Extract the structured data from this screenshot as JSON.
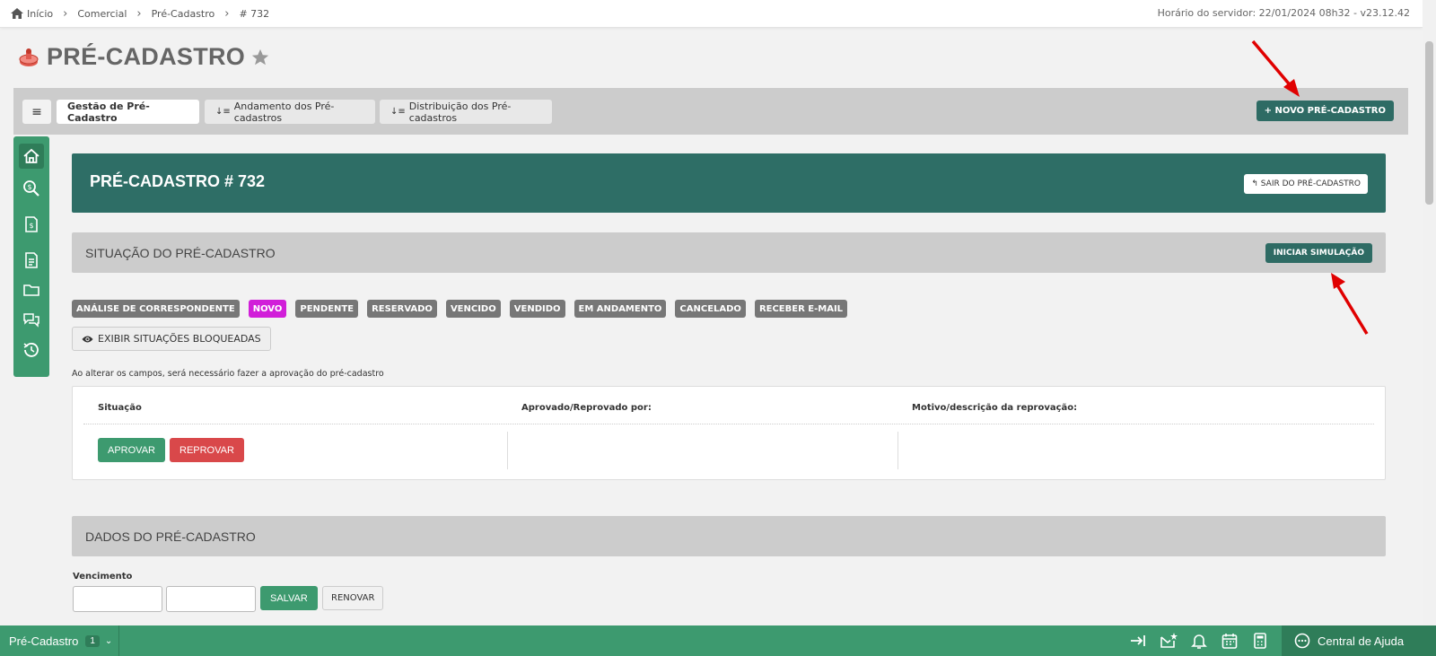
{
  "breadcrumb": {
    "items": [
      "Início",
      "Comercial",
      "Pré-Cadastro",
      "# 732"
    ]
  },
  "server_time": "Horário do servidor: 22/01/2024 08h32 - v23.12.42",
  "page": {
    "title": "PRÉ-CADASTRO"
  },
  "tabs": {
    "menu_glyph": "≡",
    "sort_glyph": "↓≡",
    "items": [
      "Gestão de Pré-Cadastro",
      "Andamento dos Pré-cadastros",
      "Distribuição dos Pré-cadastros"
    ],
    "new_button": "+ NOVO PRÉ-CADASTRO"
  },
  "header": {
    "title": "PRÉ-CADASTRO # 732",
    "exit_button": "↰ SAIR DO PRÉ-CADASTRO"
  },
  "situacao": {
    "title": "SITUAÇÃO DO PRÉ-CADASTRO",
    "start_button": "INICIAR SIMULAÇÃO",
    "badges": [
      "ANÁLISE DE CORRESPONDENTE",
      "NOVO",
      "PENDENTE",
      "RESERVADO",
      "VENCIDO",
      "VENDIDO",
      "EM ANDAMENTO",
      "CANCELADO",
      "RECEBER E-MAIL"
    ],
    "show_blocked": "EXIBIR SITUAÇÕES BLOQUEADAS",
    "note": "Ao alterar os campos, será necessário fazer a aprovação do pré-cadastro",
    "table_headers": [
      "Situação",
      "Aprovado/Reprovado por:",
      "Motivo/descrição da reprovação:"
    ],
    "approve": "APROVAR",
    "reject": "REPROVAR"
  },
  "dados": {
    "title": "DADOS DO PRÉ-CADASTRO",
    "vencimento_label": "Vencimento",
    "save": "SALVAR",
    "renew": "RENOVAR"
  },
  "bottom": {
    "module": "Pré-Cadastro",
    "count": "1",
    "chevron": "⌄",
    "help": "Central de Ajuda"
  },
  "colors": {
    "primary_dark": "#2e6b64",
    "primary_green": "#3d9a6f",
    "danger": "#d9484a",
    "badge_highlight": "#d11fd9",
    "badge_default": "#777777"
  }
}
